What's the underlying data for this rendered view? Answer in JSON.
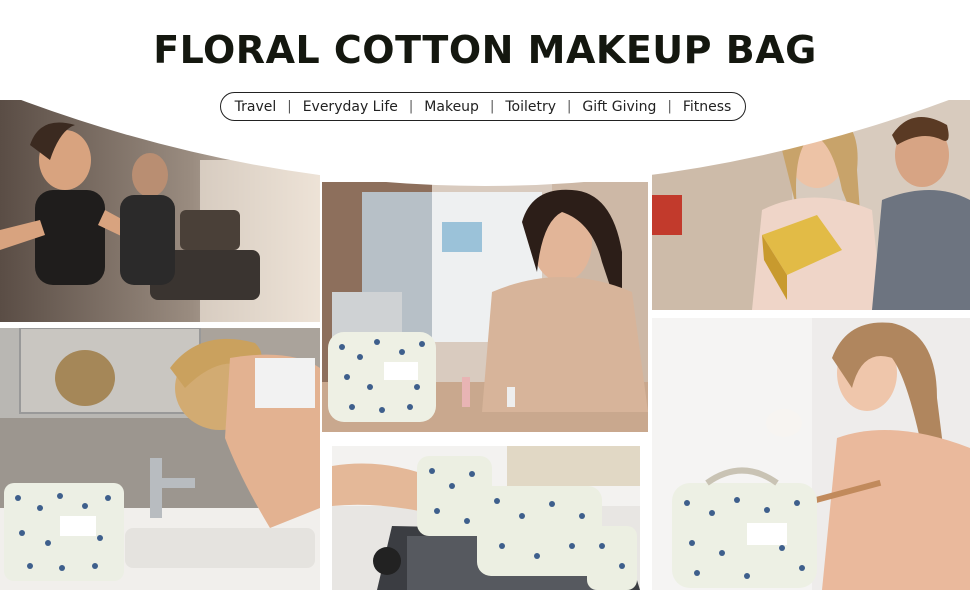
{
  "title": "FLORAL COTTON MAKEUP BAG",
  "tags": [
    "Travel",
    "Everyday Life",
    "Makeup",
    "Toiletry",
    "Gift Giving",
    "Fitness"
  ]
}
